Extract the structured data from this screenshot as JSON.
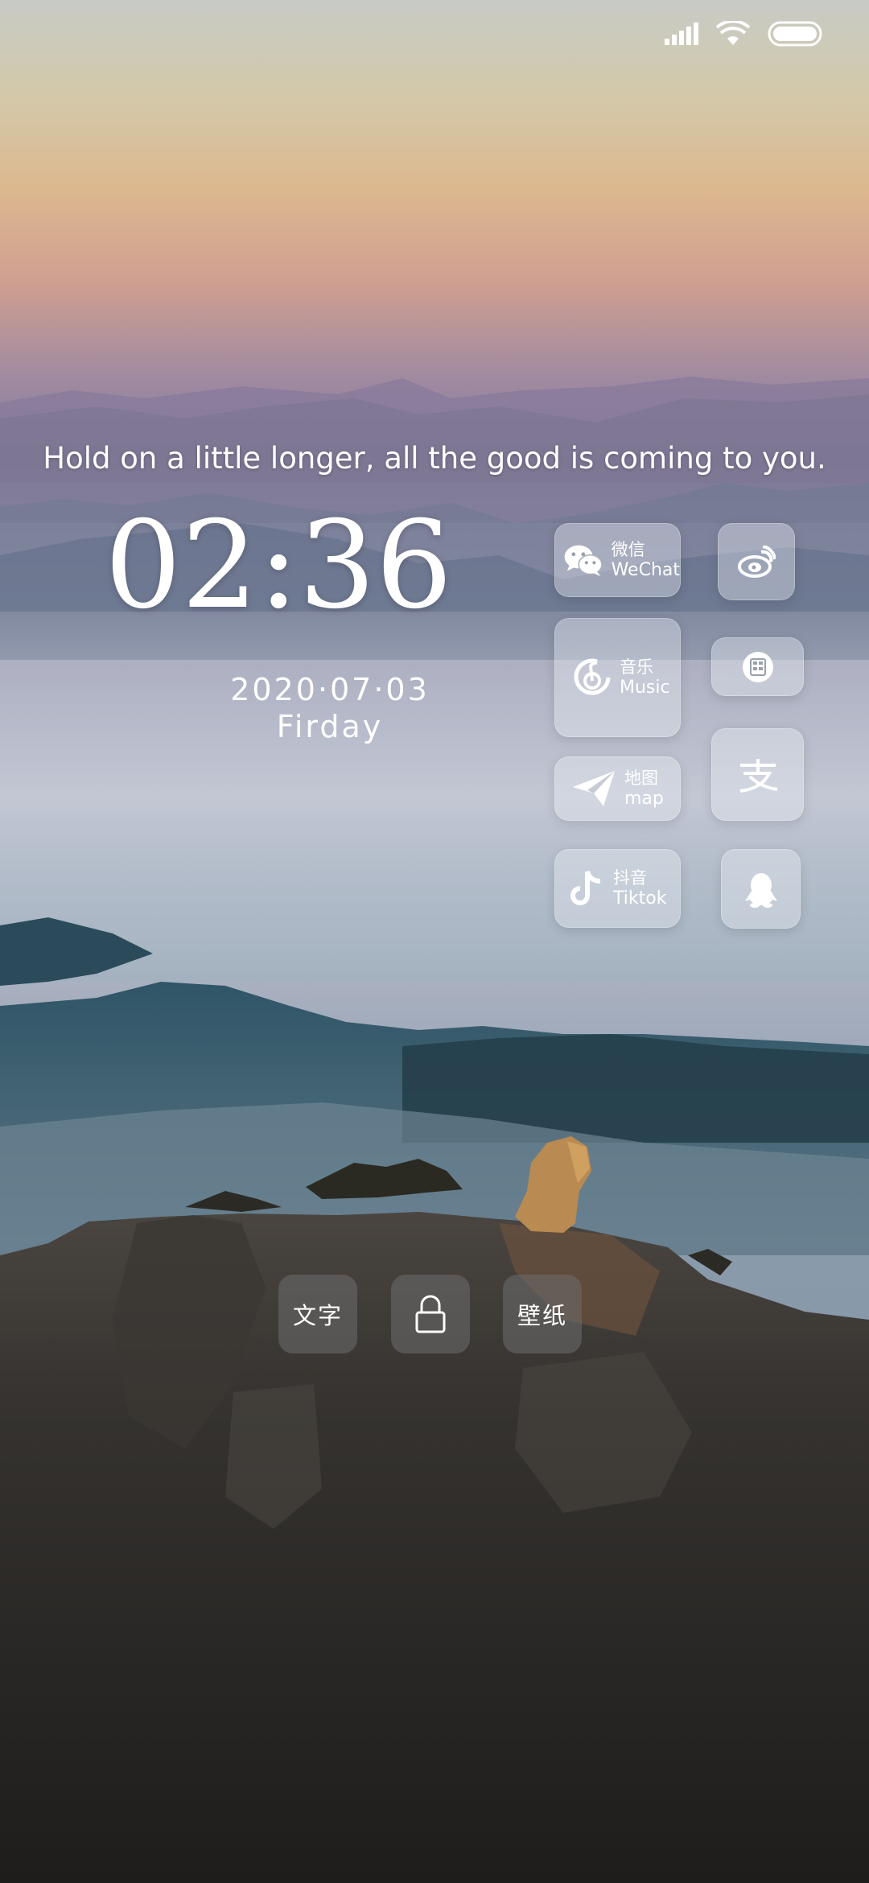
{
  "status_bar": {
    "signal_icon": "signal-bars-icon",
    "wifi_icon": "wifi-icon",
    "battery_icon": "battery-icon"
  },
  "quote": "Hold on a little longer, all the good is coming to you.",
  "clock": {
    "time": "02:36",
    "date": "2020·07·03",
    "day": "Firday"
  },
  "shortcuts": [
    {
      "cn": "微信",
      "en": "WeChat",
      "icon": "wechat-icon"
    },
    {
      "icon": "weibo-icon"
    },
    {
      "cn": "音乐",
      "en": "Music",
      "icon": "netease-music-icon"
    },
    {
      "icon": "calculator-icon"
    },
    {
      "cn": "地图",
      "en": "map",
      "icon": "paper-plane-icon"
    },
    {
      "icon": "alipay-icon"
    },
    {
      "cn": "抖音",
      "en": "Tiktok",
      "icon": "tiktok-icon"
    },
    {
      "icon": "qq-penguin-icon"
    }
  ],
  "bottom_buttons": {
    "text": "文字",
    "lock_icon": "lock-icon",
    "wallpaper": "壁纸"
  }
}
